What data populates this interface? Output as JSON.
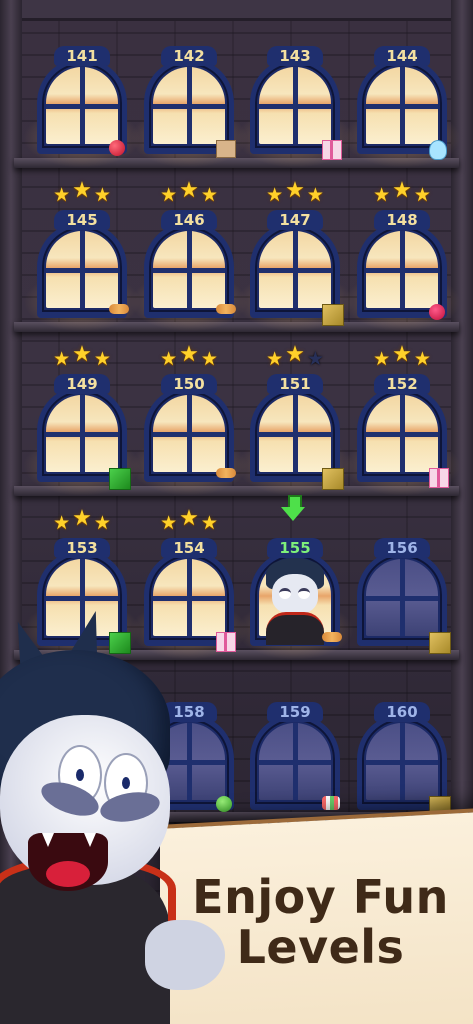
{
  "levels": [
    {
      "number": "141",
      "state": "lit",
      "stars": null,
      "item": "cherry"
    },
    {
      "number": "142",
      "state": "lit",
      "stars": null,
      "item": "box"
    },
    {
      "number": "143",
      "state": "lit",
      "stars": null,
      "item": "gift"
    },
    {
      "number": "144",
      "state": "lit",
      "stars": null,
      "item": "bear"
    },
    {
      "number": "145",
      "state": "lit",
      "stars": 3,
      "item": "worm"
    },
    {
      "number": "146",
      "state": "lit",
      "stars": 3,
      "item": "worm"
    },
    {
      "number": "147",
      "state": "lit",
      "stars": 3,
      "item": "cube-gold"
    },
    {
      "number": "148",
      "state": "lit",
      "stars": 3,
      "item": "heart"
    },
    {
      "number": "149",
      "state": "lit",
      "stars": 3,
      "item": "cube-green"
    },
    {
      "number": "150",
      "state": "lit",
      "stars": 3,
      "item": "worm"
    },
    {
      "number": "151",
      "state": "lit",
      "stars": 2,
      "item": "cube-gold"
    },
    {
      "number": "152",
      "state": "lit",
      "stars": 3,
      "item": "gift"
    },
    {
      "number": "153",
      "state": "lit",
      "stars": 3,
      "item": "cube-green"
    },
    {
      "number": "154",
      "state": "lit",
      "stars": 3,
      "item": "gift"
    },
    {
      "number": "155",
      "state": "current",
      "stars": null,
      "item": "worm"
    },
    {
      "number": "156",
      "state": "locked",
      "stars": null,
      "item": "cube-gold"
    },
    {
      "number": "158",
      "state": "locked",
      "stars": null,
      "item": "drop"
    },
    {
      "number": "159",
      "state": "locked",
      "stars": null,
      "item": "candy"
    },
    {
      "number": "160",
      "state": "locked",
      "stars": null,
      "item": "cube-gold"
    }
  ],
  "current_level_indicator": "down-arrow-icon",
  "tagline": {
    "line1": "Enjoy Fun",
    "line2": "Levels"
  },
  "colors": {
    "window_frame": "#1f2f6e",
    "level_number": "#f3e0a0",
    "current_level_number": "#7ef07a",
    "star": "#ffd12a",
    "tagline_text": "#3f2a18",
    "banner": "#fbf0dc"
  }
}
